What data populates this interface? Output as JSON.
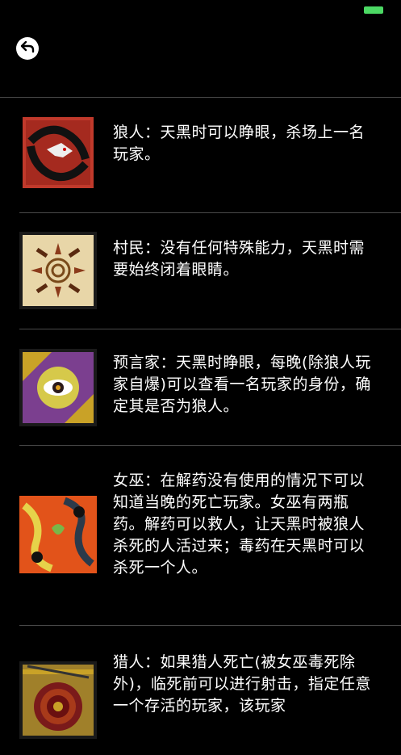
{
  "nav": {
    "back_icon": "back-arrow-icon"
  },
  "colors": {
    "background": "#000000",
    "divider": "#4a4a4a",
    "battery": "#4cd964"
  },
  "roles": [
    {
      "key": "werewolf",
      "icon": "werewolf-card-icon",
      "text": "狼人：天黑时可以睁眼，杀场上一名玩家。"
    },
    {
      "key": "villager",
      "icon": "villager-card-icon",
      "text": "村民：没有任何特殊能力，天黑时需要始终闭着眼睛。"
    },
    {
      "key": "seer",
      "icon": "seer-card-icon",
      "text": "预言家：天黑时睁眼，每晚(除狼人玩家自爆)可以查看一名玩家的身份，确定其是否为狼人。"
    },
    {
      "key": "witch",
      "icon": "witch-card-icon",
      "text": "女巫：在解药没有使用的情况下可以知道当晚的死亡玩家。女巫有两瓶药。解药可以救人，让天黑时被狼人杀死的人活过来；毒药在天黑时可以杀死一个人。"
    },
    {
      "key": "hunter",
      "icon": "hunter-card-icon",
      "text": "猎人：如果猎人死亡(被女巫毒死除外)，临死前可以进行射击，指定任意一个存活的玩家，该玩家"
    }
  ]
}
